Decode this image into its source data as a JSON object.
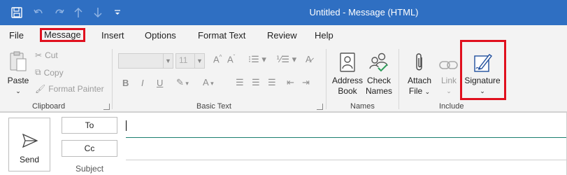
{
  "window": {
    "title": "Untitled  -  Message (HTML)"
  },
  "tabs": [
    "File",
    "Message",
    "Insert",
    "Options",
    "Format Text",
    "Review",
    "Help"
  ],
  "active_tab": "Message",
  "clipboard": {
    "paste": "Paste",
    "cut": "Cut",
    "copy": "Copy",
    "format_painter": "Format Painter",
    "group_label": "Clipboard"
  },
  "basic_text": {
    "font_size": "11",
    "bold": "B",
    "italic": "I",
    "underline": "U",
    "group_label": "Basic Text"
  },
  "names": {
    "address_book_1": "Address",
    "address_book_2": "Book",
    "check_names_1": "Check",
    "check_names_2": "Names",
    "group_label": "Names"
  },
  "include": {
    "attach_file_1": "Attach",
    "attach_file_2": "File",
    "link": "Link",
    "signature": "Signature",
    "group_label": "Include"
  },
  "compose": {
    "send": "Send",
    "to": "To",
    "cc": "Cc",
    "subject": "Subject"
  },
  "colors": {
    "titlebar": "#2f6fc2",
    "highlight": "#e0101e",
    "ribbon": "#f3f3f3"
  }
}
